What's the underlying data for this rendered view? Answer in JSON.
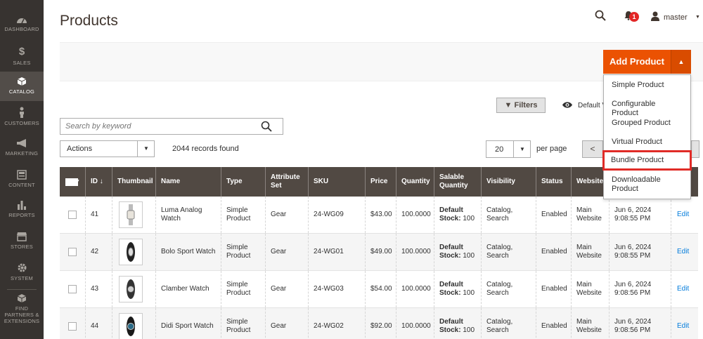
{
  "sidebar": {
    "items": [
      {
        "label": "DASHBOARD",
        "icon": "dashboard-icon"
      },
      {
        "label": "SALES",
        "icon": "dollar-icon"
      },
      {
        "label": "CATALOG",
        "icon": "box-icon"
      },
      {
        "label": "CUSTOMERS",
        "icon": "person-icon"
      },
      {
        "label": "MARKETING",
        "icon": "megaphone-icon"
      },
      {
        "label": "CONTENT",
        "icon": "content-icon"
      },
      {
        "label": "REPORTS",
        "icon": "bar-chart-icon"
      },
      {
        "label": "STORES",
        "icon": "store-icon"
      },
      {
        "label": "SYSTEM",
        "icon": "gear-icon"
      },
      {
        "label": "FIND PARTNERS & EXTENSIONS",
        "icon": "cube-icon"
      }
    ],
    "active": "CATALOG"
  },
  "header": {
    "title": "Products",
    "notification_count": "1",
    "username": "master"
  },
  "toolbar": {
    "add_button": "Add Product",
    "dropdown": [
      "Simple Product",
      "Configurable Product",
      "Grouped Product",
      "Virtual Product",
      "Bundle Product",
      "Downloadable Product"
    ],
    "highlighted": "Bundle Product"
  },
  "filters": {
    "filters_label": "Filters",
    "default_view": "Default V",
    "search_placeholder": "Search by keyword",
    "actions_label": "Actions",
    "records": "2044 records found",
    "per_page_value": "20",
    "per_page_label": "per page",
    "prev": "<"
  },
  "table": {
    "columns": [
      "",
      "ID ↓",
      "Thumbnail",
      "Name",
      "Type",
      "Attribute Set",
      "SKU",
      "Price",
      "Quantity",
      "Salable Quantity",
      "Visibility",
      "Status",
      "Websites",
      "",
      ""
    ],
    "rows": [
      {
        "id": "41",
        "name": "Luma Analog Watch",
        "type": "Simple Product",
        "set": "Gear",
        "sku": "24-WG09",
        "price": "$43.00",
        "qty": "100.0000",
        "stock_label": "Default Stock:",
        "stock_val": "100",
        "visibility": "Catalog, Search",
        "status": "Enabled",
        "website": "Main Website",
        "date": "Jun 6, 2024 9:08:55 PM",
        "action": "Edit"
      },
      {
        "id": "42",
        "name": "Bolo Sport Watch",
        "type": "Simple Product",
        "set": "Gear",
        "sku": "24-WG01",
        "price": "$49.00",
        "qty": "100.0000",
        "stock_label": "Default Stock:",
        "stock_val": "100",
        "visibility": "Catalog, Search",
        "status": "Enabled",
        "website": "Main Website",
        "date": "Jun 6, 2024 9:08:55 PM",
        "action": "Edit"
      },
      {
        "id": "43",
        "name": "Clamber Watch",
        "type": "Simple Product",
        "set": "Gear",
        "sku": "24-WG03",
        "price": "$54.00",
        "qty": "100.0000",
        "stock_label": "Default Stock:",
        "stock_val": "100",
        "visibility": "Catalog, Search",
        "status": "Enabled",
        "website": "Main Website",
        "date": "Jun 6, 2024 9:08:56 PM",
        "action": "Edit"
      },
      {
        "id": "44",
        "name": "Didi Sport Watch",
        "type": "Simple Product",
        "set": "Gear",
        "sku": "24-WG02",
        "price": "$92.00",
        "qty": "100.0000",
        "stock_label": "Default Stock:",
        "stock_val": "100",
        "visibility": "Catalog, Search",
        "status": "Enabled",
        "website": "Main Website",
        "date": "Jun 6, 2024 9:08:56 PM",
        "action": "Edit"
      }
    ]
  },
  "colors": {
    "accent": "#eb5202",
    "sidebar": "#373330",
    "table_header": "#514943",
    "link": "#007bdb",
    "highlight": "#e02b27"
  }
}
